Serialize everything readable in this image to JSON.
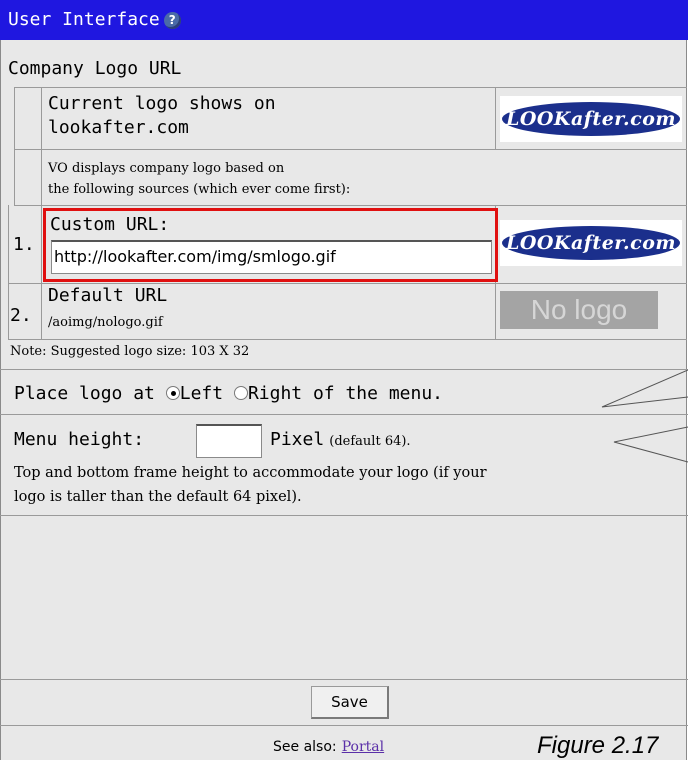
{
  "title": {
    "text": "User Interface",
    "help_icon": "help-icon"
  },
  "company_logo": {
    "section_label": "Company Logo URL",
    "current_logo_line1": "Current logo shows on",
    "current_logo_line2": "lookafter.com",
    "current_logo_image": "LOOKafter.com",
    "sources_note_line1": "VO displays company logo based on",
    "sources_note_line2": "the following sources (which ever come first):",
    "custom_index": "1.",
    "custom_label": "Custom URL:",
    "custom_url_value": "http://lookafter.com/img/smlogo.gif",
    "custom_logo_image": "LOOKafter.com",
    "default_index": "2.",
    "default_label": "Default URL",
    "default_path": "/aoimg/nologo.gif",
    "default_logo_text": "No logo",
    "size_note": "Note: Suggested logo size: 103 X 32"
  },
  "placement": {
    "prefix": "Place logo at",
    "left_label": "Left",
    "right_label": "Right of the menu.",
    "selected": "Left"
  },
  "menu_height": {
    "label": "Menu height:",
    "value": "",
    "unit": "Pixel",
    "default_note": "(default 64).",
    "description_line1": "Top and bottom frame height to accommodate your logo (if your",
    "description_line2": "logo is taller than the default 64 pixel)."
  },
  "actions": {
    "save_label": "Save"
  },
  "footer": {
    "see_also": "See also:",
    "portal_link": "Portal",
    "figure_caption": "Figure 2.17"
  },
  "colors": {
    "titlebar": "#1f17e0",
    "panel": "#e8e8e8",
    "highlight_border": "#e01010",
    "logo_blue": "#1b2f8c",
    "link": "#5a2fa8"
  }
}
